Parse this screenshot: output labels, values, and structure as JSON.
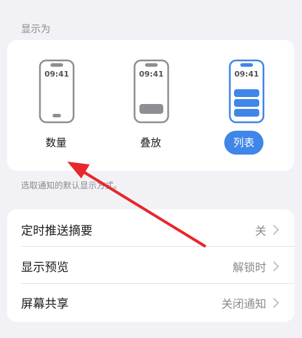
{
  "section_header": "显示为",
  "display_options": [
    {
      "label": "数量",
      "time": "09:41",
      "selected": false
    },
    {
      "label": "叠放",
      "time": "09:41",
      "selected": false
    },
    {
      "label": "列表",
      "time": "09:41",
      "selected": true
    }
  ],
  "footnote": "选取通知的默认显示方式。",
  "settings": [
    {
      "label": "定时推送摘要",
      "value": "关"
    },
    {
      "label": "显示预览",
      "value": "解锁时"
    },
    {
      "label": "屏幕共享",
      "value": "关闭通知"
    }
  ],
  "colors": {
    "accent": "#3f86e8",
    "arrow": "#e8262b",
    "background": "#f2f2f6"
  },
  "icons": [
    "phone-count-icon",
    "phone-stack-icon",
    "phone-list-icon",
    "chevron-right-icon",
    "annotation-arrow-icon"
  ]
}
